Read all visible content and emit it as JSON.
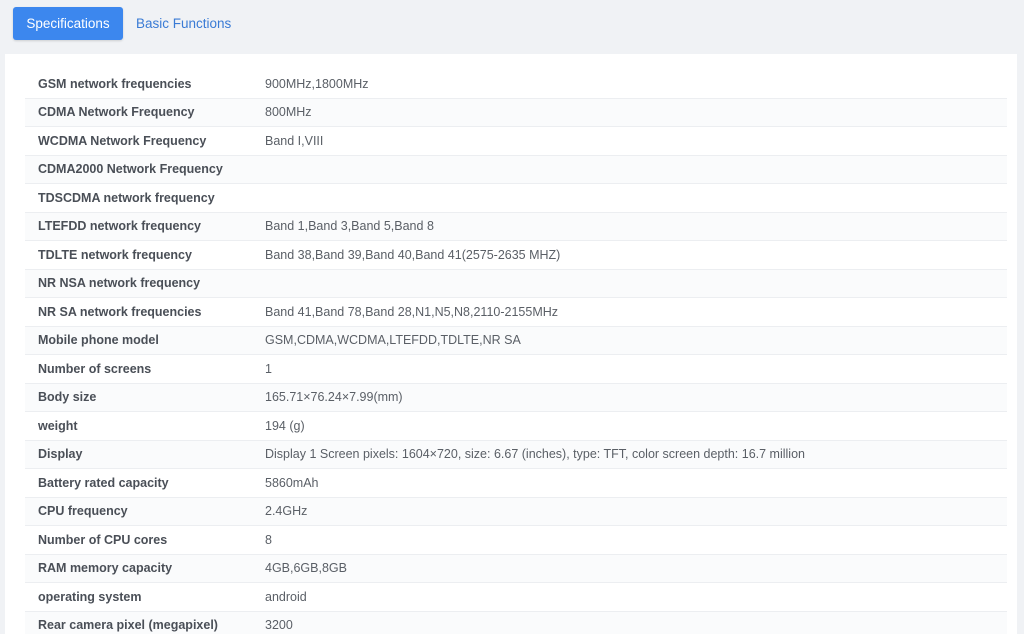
{
  "tabs": {
    "specifications": "Specifications",
    "basic_functions": "Basic Functions"
  },
  "specs": [
    {
      "label": "GSM network frequencies",
      "value": "900MHz,1800MHz"
    },
    {
      "label": "CDMA Network Frequency",
      "value": "800MHz"
    },
    {
      "label": "WCDMA Network Frequency",
      "value": "Band I,VIII"
    },
    {
      "label": "CDMA2000 Network Frequency",
      "value": ""
    },
    {
      "label": "TDSCDMA network frequency",
      "value": ""
    },
    {
      "label": "LTEFDD network frequency",
      "value": "Band 1,Band 3,Band 5,Band 8"
    },
    {
      "label": "TDLTE network frequency",
      "value": "Band 38,Band 39,Band 40,Band 41(2575-2635 MHZ)"
    },
    {
      "label": "NR NSA network frequency",
      "value": ""
    },
    {
      "label": "NR SA network frequencies",
      "value": "Band 41,Band 78,Band 28,N1,N5,N8,2110-2155MHz"
    },
    {
      "label": "Mobile phone model",
      "value": "GSM,CDMA,WCDMA,LTEFDD,TDLTE,NR SA"
    },
    {
      "label": "Number of screens",
      "value": "1"
    },
    {
      "label": "Body size",
      "value": "165.71×76.24×7.99(mm)"
    },
    {
      "label": "weight",
      "value": "194 (g)"
    },
    {
      "label": "Display",
      "value": "Display 1 Screen pixels: 1604×720, size: 6.67 (inches), type: TFT, color screen depth: 16.7 million"
    },
    {
      "label": "Battery rated capacity",
      "value": "5860mAh"
    },
    {
      "label": "CPU frequency",
      "value": "2.4GHz"
    },
    {
      "label": "Number of CPU cores",
      "value": "8"
    },
    {
      "label": "RAM memory capacity",
      "value": "4GB,6GB,8GB"
    },
    {
      "label": "operating system",
      "value": "android"
    },
    {
      "label": "Rear camera pixel (megapixel)",
      "value": "3200"
    }
  ]
}
